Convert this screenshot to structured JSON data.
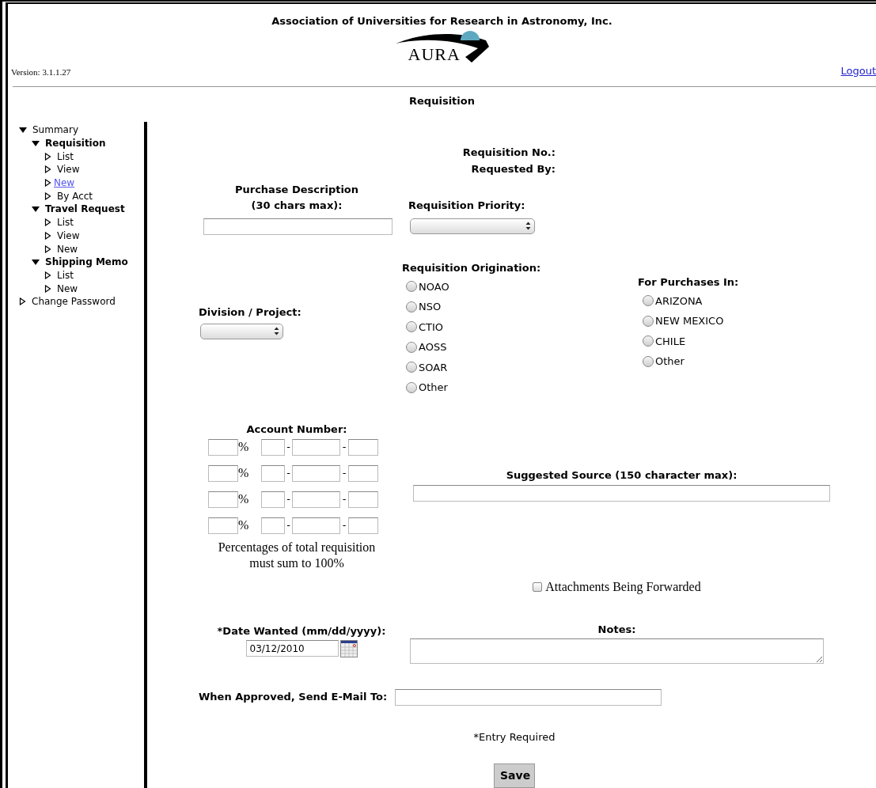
{
  "header": {
    "organization": "Association of Universities for Research in Astronomy, Inc.",
    "logo_text": "AURA",
    "version": "Version: 3.1.1.27",
    "logout": "Logout"
  },
  "page_title": "Requisition",
  "sidebar": {
    "items": [
      {
        "label": "Summary",
        "expanded": true,
        "children": [
          {
            "label": "Requisition",
            "expanded": true,
            "children": [
              {
                "label": "List",
                "selected": false
              },
              {
                "label": "View",
                "selected": false
              },
              {
                "label": "New",
                "selected": true
              },
              {
                "label": "By Acct",
                "selected": false
              }
            ]
          },
          {
            "label": "Travel Request",
            "expanded": true,
            "children": [
              {
                "label": "List",
                "selected": false
              },
              {
                "label": "View",
                "selected": false
              },
              {
                "label": "New",
                "selected": false
              }
            ]
          },
          {
            "label": "Shipping Memo",
            "expanded": true,
            "children": [
              {
                "label": "List",
                "selected": false
              },
              {
                "label": "New",
                "selected": false
              }
            ]
          }
        ]
      },
      {
        "label": "Change Password",
        "selected": false
      }
    ]
  },
  "form": {
    "requisition_no_label": "Requisition No.:",
    "requested_by_label": "Requested By:",
    "purchase_description": {
      "label": "Purchase Description (30 chars max):"
    },
    "priority": {
      "label": "Requisition Priority:"
    },
    "division": {
      "label": "Division / Project:"
    },
    "origination": {
      "label": "Requisition Origination:",
      "options": [
        {
          "label": "NOAO",
          "selected": false
        },
        {
          "label": "NSO",
          "selected": false
        },
        {
          "label": "CTIO",
          "selected": false
        },
        {
          "label": "AOSS",
          "selected": false
        },
        {
          "label": "SOAR",
          "selected": false
        },
        {
          "label": "Other",
          "selected": false
        }
      ]
    },
    "purchases_in": {
      "label": "For Purchases In:",
      "options": [
        {
          "label": "ARIZONA",
          "selected": false
        },
        {
          "label": "NEW MEXICO",
          "selected": false
        },
        {
          "label": "CHILE",
          "selected": false
        },
        {
          "label": "Other",
          "selected": false
        }
      ]
    },
    "account": {
      "label": "Account Number:",
      "rows": [
        {
          "percent": "%",
          "separators": [
            "-",
            "-"
          ]
        },
        {
          "percent": "%",
          "separators": [
            "-",
            "-"
          ]
        },
        {
          "percent": "%",
          "separators": [
            "-",
            "-"
          ]
        },
        {
          "percent": "%",
          "separators": [
            "-",
            "-"
          ]
        }
      ],
      "note": "Percentages of total requisition must sum to 100%"
    },
    "suggested_source": {
      "label": "Suggested Source (150 character max):"
    },
    "attachments": {
      "label": "Attachments Being Forwarded",
      "checked": false
    },
    "date_wanted": {
      "label": "*Date Wanted (mm/dd/yyyy):",
      "value": "03/12/2010"
    },
    "notes": {
      "label": "Notes:"
    },
    "email": {
      "label": "When Approved, Send E-Mail To:"
    },
    "required_note": "*Entry Required",
    "save": "Save"
  }
}
